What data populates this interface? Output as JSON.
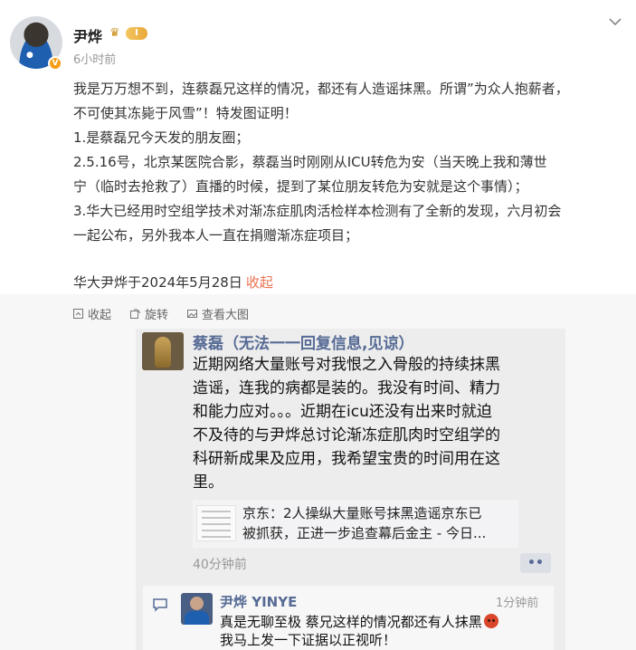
{
  "post": {
    "author": "尹烨",
    "level": "I",
    "time": "6小时前",
    "lines": [
      "我是万万想不到，连蔡磊兄这样的情况，都还有人造谣抹黑。所谓”为众人抱薪者，",
      "不可使其冻毙于风雪”！特发图证明！",
      "1.是蔡磊兄今天发的朋友圈；",
      "2.5.16号，北京某医院合影，蔡磊当时刚刚从ICU转危为安（当天晚上我和薄世",
      "宁（临时去抢救了）直播的时候，提到了某位朋友转危为安就是这个事情）；",
      "3.华大已经用时空组学技术对渐冻症肌肉活检样本检测有了全新的发现，六月初会",
      "一起公布，另外我本人一直在捐赠渐冻症项目；"
    ],
    "signature": "华大尹烨于2024年5月28日",
    "collapse": "收起"
  },
  "toolbar": {
    "collapse": "收起",
    "rotate": "旋转",
    "view_large": "查看大图"
  },
  "moment": {
    "name": "蔡磊（无法一一回复信息,见谅）",
    "lines": [
      "近期网络大量账号对我恨之入骨般的持续抹黑",
      "造谣，连我的病都是装的。我没有时间、精力",
      "和能力应对。。。近期在icu还没有出来时就迫",
      "不及待的与尹烨总讨论渐冻症肌肉时空组学的",
      "科研新成果及应用，我希望宝贵的时间用在这",
      "里。"
    ],
    "link_lines": [
      "京东：2人操纵大量账号抹黑造谣京东已",
      "被抓获，正进一步追查幕后金主 - 今日..."
    ],
    "time": "40分钟前",
    "more": "••"
  },
  "comment": {
    "name": "尹烨 YINYE",
    "time": "1分钟前",
    "line1": "真是无聊至极 蔡兄这样的情况都还有人抹黑",
    "line2": "我马上发一下证据以正视听！"
  }
}
